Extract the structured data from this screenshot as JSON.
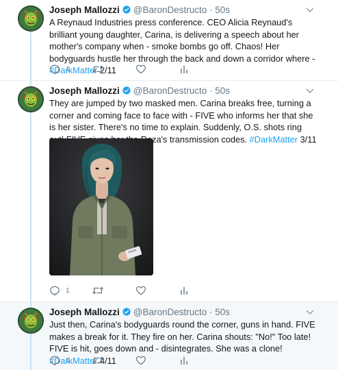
{
  "author": {
    "name": "Joseph Mallozzi",
    "handle": "@BaronDestructo"
  },
  "tweets": [
    {
      "time": "50s",
      "text_main": "A Reynaud Industries press conference.  CEO Alicia Reynaud's brilliant young daughter, Carina, is delivering a speech about her mother's company when - smoke bombs go off.  Chaos!  Her bodyguards hustle her through the back and down a corridor where - ",
      "hashtag": "#DarkMatter",
      "suffix": " 2/11",
      "reply_count": "1"
    },
    {
      "time": "50s",
      "text_main": "They are jumped by two masked men. Carina breaks free, turning a corner and coming face to face with - FIVE who informs her that she is her sister.  There's no time to explain.  Suddenly, O.S. shots ring out!  FIVE gives her the Raza's transmission codes. ",
      "hashtag": "#DarkMatter",
      "suffix": " 3/11",
      "reply_count": "1",
      "media": "photo-woman-teal-hair-green-jacket"
    },
    {
      "time": "50s",
      "text_main": "Just then, Carina's bodyguards round the corner, guns in hand.  FIVE makes a break for it.  They fire on her.  Carina shouts: \"No!\" Too late!  FIVE is hit, goes down and - disintegrates.  She was a clone!  ",
      "hashtag": "#DarkMatter",
      "suffix": " 4/11",
      "reply_count": "1"
    }
  ],
  "colors": {
    "link": "#1da1f2",
    "muted": "#657786",
    "thread_line": "#c4e4f8",
    "highlight_bg": "#f5f8fa"
  },
  "icons": [
    "avatar-icon",
    "verified-badge-icon",
    "caret-down-icon",
    "reply-icon",
    "retweet-icon",
    "like-icon",
    "analytics-icon"
  ]
}
